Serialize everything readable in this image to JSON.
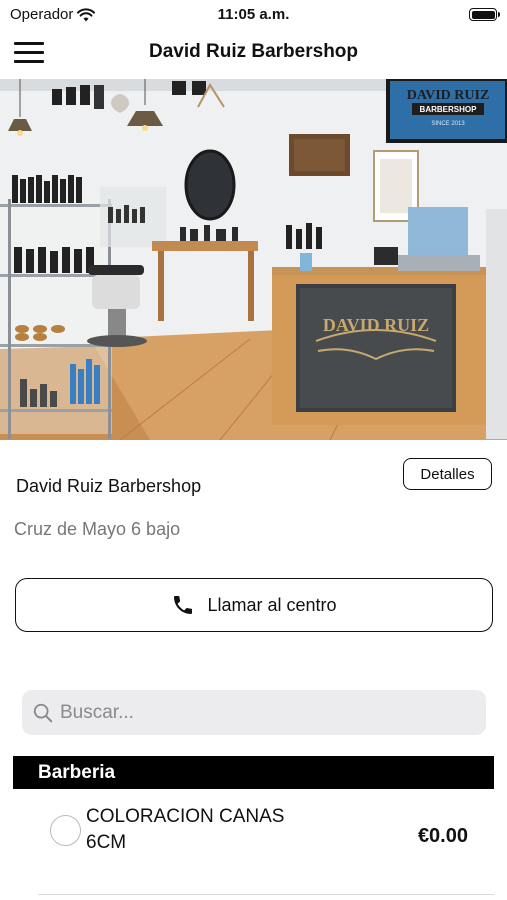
{
  "status_bar": {
    "carrier": "Operador",
    "time": "11:05 a.m.",
    "icons": [
      "wifi-icon",
      "battery-icon"
    ]
  },
  "nav": {
    "title": "David Ruiz Barbershop",
    "menu_icon": "hamburger-menu-icon"
  },
  "hero": {
    "sign_line1": "DAVID RUIZ",
    "sign_line2": "BARBERSHOP",
    "sign_line3": "SINCE 2013",
    "counter_text": "DAVID RUIZ"
  },
  "shop": {
    "name": "David Ruiz Barbershop",
    "address": "Cruz de Mayo 6 bajo",
    "details_label": "Detalles",
    "call_label": "Llamar al centro",
    "call_icon": "phone-icon"
  },
  "search": {
    "placeholder": "Buscar...",
    "value": ""
  },
  "category": {
    "name": "Barberia"
  },
  "services": [
    {
      "name": "COLORACION CANAS 6CM",
      "price": "€0.00"
    }
  ]
}
